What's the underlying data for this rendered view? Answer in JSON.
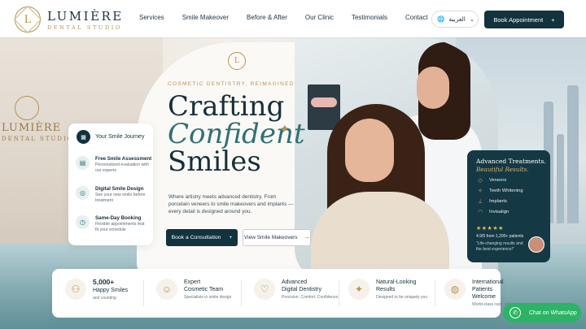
{
  "brand": {
    "name": "LUMIÈRE",
    "subtitle": "DENTAL STUDIO",
    "monogram": "L",
    "background_name": "LUMIÈRE",
    "background_sub": "DENTAL STUDIO"
  },
  "nav": {
    "items": [
      "Services",
      "Smile Makeover",
      "Before & After",
      "Our Clinic",
      "Testimonials",
      "Contact"
    ]
  },
  "language": {
    "label": "العربية"
  },
  "header_cta": {
    "label": "Book Appointment",
    "icon": "+"
  },
  "hero": {
    "eyebrow": "COSMETIC DENTISTRY, REIMAGINED",
    "title_line1": "Crafting",
    "title_line2": "Confident",
    "title_line3": "Smiles",
    "description": "Where artistry meets advanced dentistry. From porcelain veneers to smile makeovers and implants — every detail is designed around you.",
    "primary_button": "Book a Consultation",
    "primary_icon": "+",
    "secondary_button": "View Smile Makeovers",
    "secondary_icon": "→"
  },
  "journey": {
    "title": "Your Smile Journey",
    "steps": [
      {
        "title": "Free Smile Assessment",
        "desc": "Personalized evaluation with our experts",
        "icon": "clipboard-icon"
      },
      {
        "title": "Digital Smile Design",
        "desc": "See your new smile before treatment",
        "icon": "scan-icon"
      },
      {
        "title": "Same-Day Booking",
        "desc": "Flexible appointments that fit your schedule",
        "icon": "clock-icon"
      }
    ]
  },
  "advanced": {
    "title": "Advanced Treatments.",
    "subtitle": "Beautiful Results.",
    "items": [
      "Veneers",
      "Teeth Whitening",
      "Implants",
      "Invisalign"
    ],
    "stars": "★★★★★",
    "rating": "4.9/5 from 1,200+ patients",
    "quote": "“Life-changing results and the best experience!”"
  },
  "stats": [
    {
      "title": "5,000+",
      "title2": "Happy Smiles",
      "desc": "and counting",
      "icon": "people-icon"
    },
    {
      "title": "Expert",
      "title2": "Cosmetic Team",
      "desc": "Specialists in smile design",
      "icon": "dentist-icon"
    },
    {
      "title": "Advanced",
      "title2": "Digital Dentistry",
      "desc": "Precision. Comfort. Confidence.",
      "icon": "tooth-icon"
    },
    {
      "title": "Natural-Looking",
      "title2": "Results",
      "desc": "Designed to be uniquely you",
      "icon": "sparkle-icon"
    },
    {
      "title": "International",
      "title2": "Patients Welcome",
      "desc": "World-class care, always",
      "icon": "globe-icon"
    }
  ],
  "whatsapp": {
    "label": "Chat on WhatsApp"
  },
  "colors": {
    "primary": "#12323d",
    "gold": "#b89252",
    "teal": "#2e7177",
    "whatsapp": "#2bb465"
  }
}
